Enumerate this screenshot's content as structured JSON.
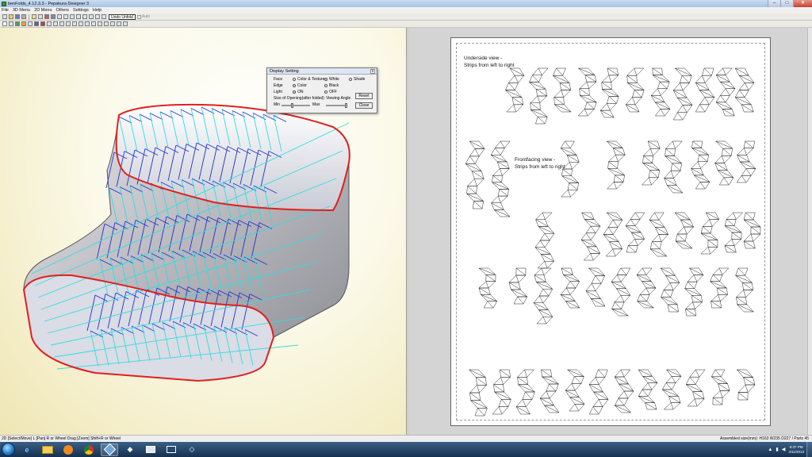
{
  "window": {
    "title": "benFolds_4.12.3.3 - Pepakura Designer 3",
    "buttons": [
      "–",
      "□",
      "✕"
    ]
  },
  "menu": {
    "items": [
      "File",
      "3D Menu",
      "2D Menu",
      "Others",
      "Settings",
      "Help"
    ]
  },
  "toolbar": {
    "undo_label": "Undo Unfold",
    "auto_label": "Auto"
  },
  "dialog": {
    "title": "Display Setting",
    "close": "x",
    "face_label": "Face",
    "face_options": [
      "Color & Texture",
      "White",
      "Shade"
    ],
    "edge_label": "Edge",
    "edge_options": [
      "Color",
      "Black"
    ],
    "light_label": "Light",
    "light_options": [
      "ON",
      "OFF"
    ],
    "opening_label": "Size of Opening(after folded)",
    "angle_label": "Viewing Angle",
    "min_label": "Min",
    "max_label": "Max",
    "reset_label": "Reset",
    "close_label": "Close"
  },
  "paper": {
    "caption1_line1": "Underside view -",
    "caption1_line2": "Strips from left to right",
    "caption2_line1": "Frontfacing view -",
    "caption2_line2": "Strips from left to right"
  },
  "status": {
    "left": "2D [Select/Move] L [Pan] R or Wheel Drag [Zoom] Shift+R or Wheel",
    "right": "Assembled size(mm): H163 W235 D227 / Parts 45"
  },
  "taskbar": {
    "time": "8:37 PM",
    "date": "4/11/2013"
  },
  "colors": {
    "cut_edge": "#e0201e",
    "mountain_fold": "#2233cc",
    "valley_fold": "#33dddd",
    "mesh_face": "#c8c8cc"
  }
}
